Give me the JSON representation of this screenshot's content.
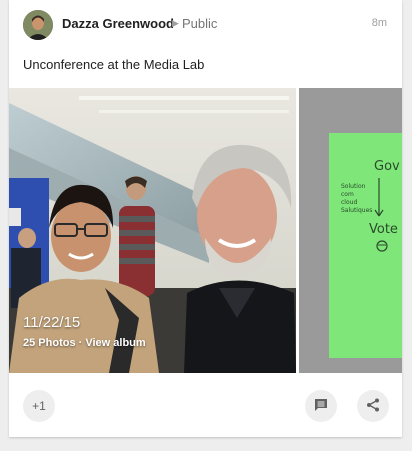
{
  "post": {
    "author": "Dazza Greenwood",
    "visibility": "Public",
    "time": "8m",
    "text": "Unconference at the Media Lab"
  },
  "album": {
    "date": "11/22/15",
    "count_label": "25 Photos · View album"
  },
  "actions": {
    "plus_one_label": "+1"
  },
  "icons": {
    "avatar": "author-avatar",
    "visibility_arrow": "caret-right-icon",
    "comment": "comment-icon",
    "share": "share-icon"
  }
}
